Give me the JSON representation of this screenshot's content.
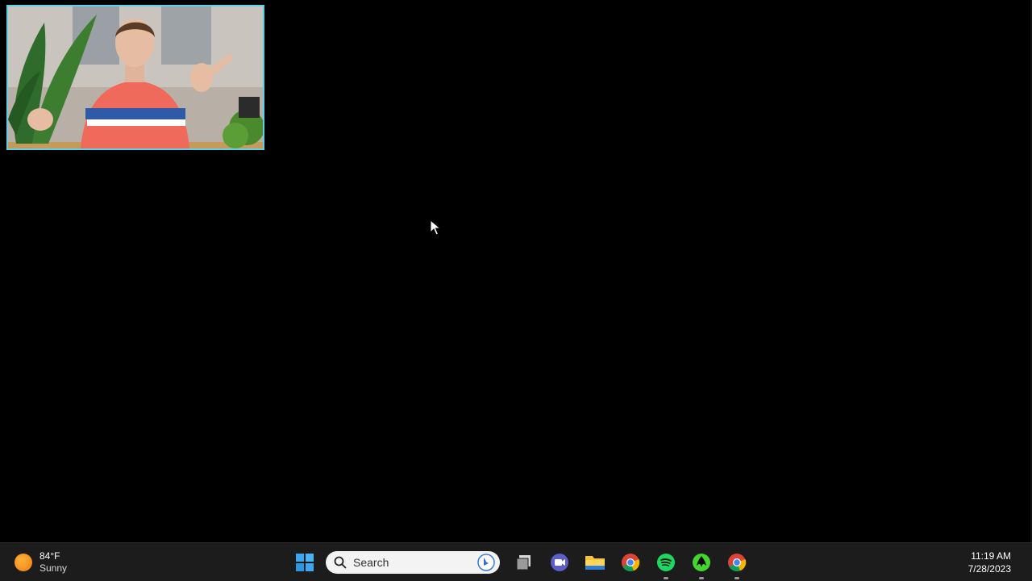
{
  "weather": {
    "temperature": "84°F",
    "condition": "Sunny",
    "icon": "sun-icon"
  },
  "taskbar": {
    "start_icon": "windows-start-icon",
    "search": {
      "label": "Search",
      "icon": "search-icon",
      "badge_icon": "bing-icon"
    },
    "apps": [
      {
        "name": "task-view",
        "icon": "task-view-icon",
        "running": false
      },
      {
        "name": "teams-meet",
        "icon": "video-chat-icon",
        "running": false
      },
      {
        "name": "file-explorer",
        "icon": "folder-icon",
        "running": false
      },
      {
        "name": "chrome",
        "icon": "chrome-icon",
        "running": false
      },
      {
        "name": "spotify",
        "icon": "spotify-icon",
        "running": true
      },
      {
        "name": "razer",
        "icon": "razer-icon",
        "running": true
      },
      {
        "name": "chrome-profile",
        "icon": "chrome-icon",
        "running": true
      }
    ]
  },
  "clock": {
    "time": "11:19 AM",
    "date": "7/28/2023"
  },
  "colors": {
    "webcam_border": "#5fd0e6",
    "taskbar_bg": "#1c1c1c",
    "desktop_bg": "#000000"
  }
}
